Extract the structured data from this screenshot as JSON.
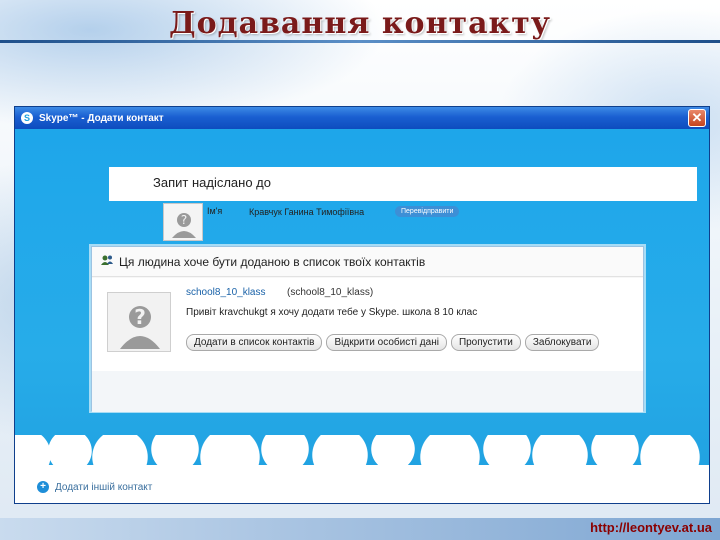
{
  "slide": {
    "title": "Додавання контакту",
    "url": "http://leontyev.at.ua"
  },
  "window": {
    "title": "Skype™ - Додати контакт",
    "close_label": "✕",
    "logo_letter": "S"
  },
  "sent_request": {
    "title": "Запит надіслано до",
    "name_label": "Ім'я",
    "name_value": "Кравчук Ганина Тимофіївна",
    "resend_label": "Перевідправити"
  },
  "incoming_request": {
    "header": "Ця людина хоче бути доданою в список твоїх контактів",
    "user": "school8_10_klass",
    "user_id": "(school8_10_klass)",
    "message": "Привіт kravchukgt я хочу додати тебе у Skype. школа 8 10 клас",
    "buttons": [
      "Додати в список контактів",
      "Відкрити особисті дані",
      "Пропустити",
      "Заблокувати"
    ]
  },
  "footer": {
    "add_another": "Додати іншій контакт"
  },
  "icons": {
    "window": "skype-icon",
    "close": "close-icon",
    "contacts": "contacts-icon",
    "avatar": "avatar-placeholder-icon",
    "add": "plus-circle-icon"
  },
  "colors": {
    "title": "#7a1a1a",
    "titlebar": "#1a5fd1",
    "sky": "#25a8e6",
    "link": "#1a62a8",
    "url": "#8a0000"
  }
}
